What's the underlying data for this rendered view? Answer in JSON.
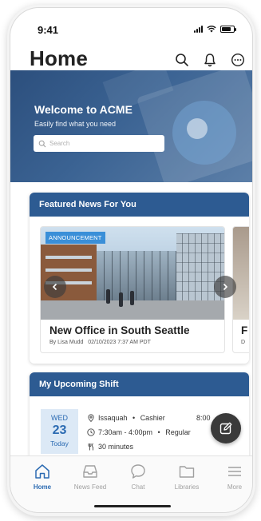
{
  "status": {
    "time": "9:41"
  },
  "header": {
    "title": "Home",
    "icons": [
      "search-icon",
      "bell-icon",
      "more-icon"
    ]
  },
  "hero": {
    "title": "Welcome to ACME",
    "subtitle": "Easily find what you need",
    "search_placeholder": "Search"
  },
  "featured": {
    "heading": "Featured News For You",
    "items": [
      {
        "badge": "ANNOUNCEMENT",
        "title": "New Office in South Seattle",
        "author": "By Lisa Mudd",
        "date": "02/10/2023 7:37 AM PDT"
      },
      {
        "title": "F",
        "meta": "D"
      }
    ]
  },
  "shift": {
    "heading": "My Upcoming Shift",
    "day_name": "WED",
    "day_num": "23",
    "day_label": "Today",
    "location": "Issaquah",
    "role": "Cashier",
    "time_range": "7:30am - 4:00pm",
    "shift_type": "Regular",
    "break": "30 minutes",
    "time_partial": "8:00"
  },
  "tabbar": {
    "items": [
      {
        "label": "Home",
        "icon": "home-icon",
        "active": true
      },
      {
        "label": "News Feed",
        "icon": "inbox-icon",
        "active": false
      },
      {
        "label": "Chat",
        "icon": "chat-icon",
        "active": false
      },
      {
        "label": "Libraries",
        "icon": "folder-icon",
        "active": false
      },
      {
        "label": "More",
        "icon": "menu-icon",
        "active": false
      }
    ]
  },
  "colors": {
    "brand": "#2d5b92",
    "accent": "#2c6bb2",
    "badge": "#3a8fd8"
  }
}
